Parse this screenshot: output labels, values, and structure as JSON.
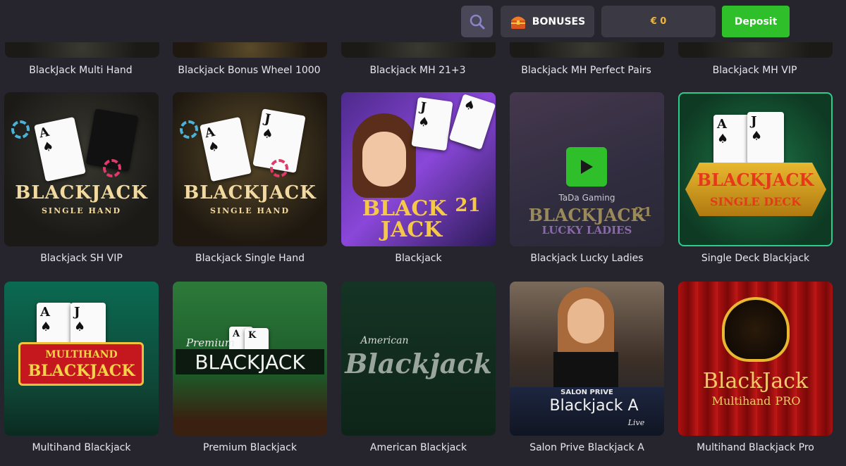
{
  "header": {
    "bonuses_label": "BONUSES",
    "balance": "€ 0",
    "deposit_label": "Deposit"
  },
  "row0": [
    {
      "title": "BlackJack Multi Hand"
    },
    {
      "title": "Blackjack Bonus Wheel 1000"
    },
    {
      "title": "Blackjack MH 21+3"
    },
    {
      "title": "Blackjack MH Perfect Pairs"
    },
    {
      "title": "Blackjack MH VIP"
    }
  ],
  "row1": [
    {
      "title": "Blackjack SH VIP",
      "logo": "BLACKJACK",
      "sub": "SINGLE HAND"
    },
    {
      "title": "Blackjack Single Hand",
      "logo": "BLACKJACK",
      "sub": "SINGLE HAND"
    },
    {
      "title": "Blackjack",
      "logo1": "BLACK",
      "logo2": "JACK",
      "badge": "21"
    },
    {
      "title": "Blackjack Lucky Ladies",
      "provider": "TaDa Gaming",
      "logo": "BLACKJACK",
      "badge": "21",
      "sub": "LUCKY LADIES"
    },
    {
      "title": "Single Deck Blackjack",
      "logo": "BLACKJACK",
      "sub": "SINGLE DECK"
    }
  ],
  "row2": [
    {
      "title": "Multihand Blackjack",
      "logo1": "MULTIHAND",
      "logo2": "BLACKJACK"
    },
    {
      "title": "Premium Blackjack",
      "logo1": "Premium",
      "logo2": "BLACKJACK"
    },
    {
      "title": "American Blackjack",
      "logo1": "American",
      "logo2": "Blackjack"
    },
    {
      "title": "Salon Prive Blackjack A",
      "logo1": "SALON PRIVE",
      "logo2": "Blackjack A",
      "logo3": "Live"
    },
    {
      "title": "Multihand Blackjack Pro",
      "logo1": "BlackJack",
      "logo2": "Multihand",
      "logo3": "PRO"
    }
  ],
  "colors": {
    "background": "#26252e",
    "deposit": "#2fbf2a",
    "balance_text": "#f0b53c"
  }
}
